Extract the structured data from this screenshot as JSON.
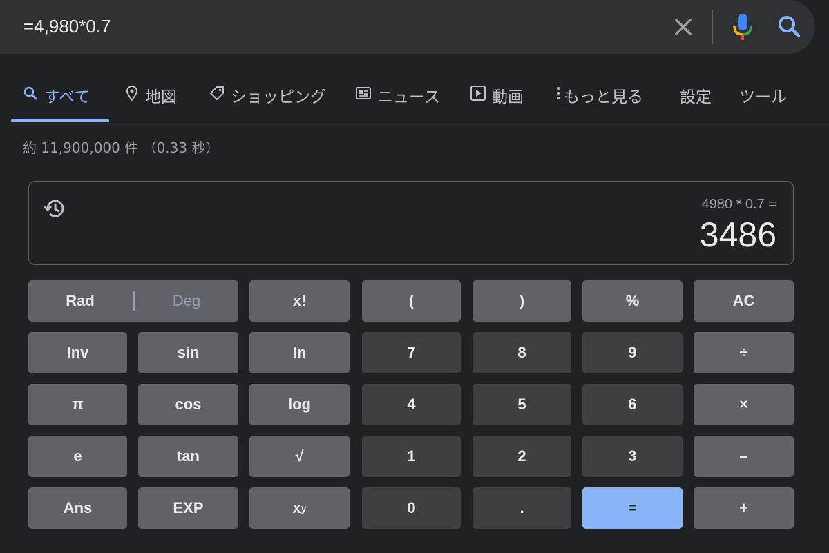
{
  "search": {
    "query": "=4,980*0.7"
  },
  "tabs": [
    {
      "label": "すべて",
      "icon": "search-icon"
    },
    {
      "label": "地図",
      "icon": "map-pin-icon"
    },
    {
      "label": "ショッピング",
      "icon": "tag-icon"
    },
    {
      "label": "ニュース",
      "icon": "newspaper-icon"
    },
    {
      "label": "動画",
      "icon": "play-icon"
    },
    {
      "label": "もっと見る",
      "icon": "more-vert-icon"
    },
    {
      "label": "設定"
    },
    {
      "label": "ツール"
    }
  ],
  "stats": "約 11,900,000 件 （0.33 秒）",
  "calculator": {
    "expression": "4980 * 0.7 =",
    "result": "3486",
    "rad": "Rad",
    "deg": "Deg",
    "keys": {
      "fact": "x!",
      "lparen": "(",
      "rparen": ")",
      "percent": "%",
      "ac": "AC",
      "inv": "Inv",
      "sin": "sin",
      "ln": "ln",
      "n7": "7",
      "n8": "8",
      "n9": "9",
      "div": "÷",
      "pi": "π",
      "cos": "cos",
      "log": "log",
      "n4": "4",
      "n5": "5",
      "n6": "6",
      "mul": "×",
      "e": "e",
      "tan": "tan",
      "sqrt": "√",
      "n1": "1",
      "n2": "2",
      "n3": "3",
      "minus": "–",
      "ans": "Ans",
      "exp": "EXP",
      "pow_base": "x",
      "pow_exp": "y",
      "n0": "0",
      "dot": ".",
      "eq": "=",
      "plus": "+"
    }
  },
  "colors": {
    "accent": "#8ab4f8",
    "background": "#202124",
    "fn_key": "#5f6368",
    "num_key": "#3c4043"
  }
}
